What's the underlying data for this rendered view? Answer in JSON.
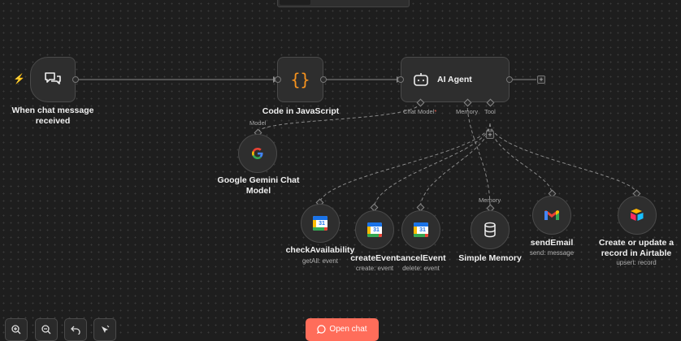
{
  "nodes": {
    "trigger": {
      "label": "When chat message received"
    },
    "code": {
      "label": "Code in JavaScript"
    },
    "agent": {
      "label": "AI Agent",
      "ports": {
        "chat_model": "Chat Model",
        "required_mark": "*",
        "memory": "Memory",
        "tool": "Tool"
      }
    },
    "gemini": {
      "label": "Google Gemini Chat Model",
      "port": "Model"
    },
    "check": {
      "label": "checkAvailability",
      "sub": "getAll: event"
    },
    "create": {
      "label": "createEvent",
      "sub": "create: event"
    },
    "cancel": {
      "label": "cancelEvent",
      "sub": "delete: event"
    },
    "memory": {
      "label": "Simple Memory",
      "port": "Memory"
    },
    "sendemail": {
      "label": "sendEmail",
      "sub": "send: message"
    },
    "airtable": {
      "label": "Create or update a record in Airtable",
      "sub": "upsert: record"
    }
  },
  "calendar_day": "31",
  "plus_symbol": "+",
  "toolbar": {
    "zoom_in": "zoom-in-icon",
    "zoom_out": "zoom-out-icon",
    "undo": "undo-icon",
    "tidy": "tidy-icon"
  },
  "open_chat": {
    "label": "Open chat"
  },
  "colors": {
    "background": "#1e1e1e",
    "node": "#2e2e2e",
    "accent": "#ff6d5a",
    "code_icon": "#f7931e"
  }
}
